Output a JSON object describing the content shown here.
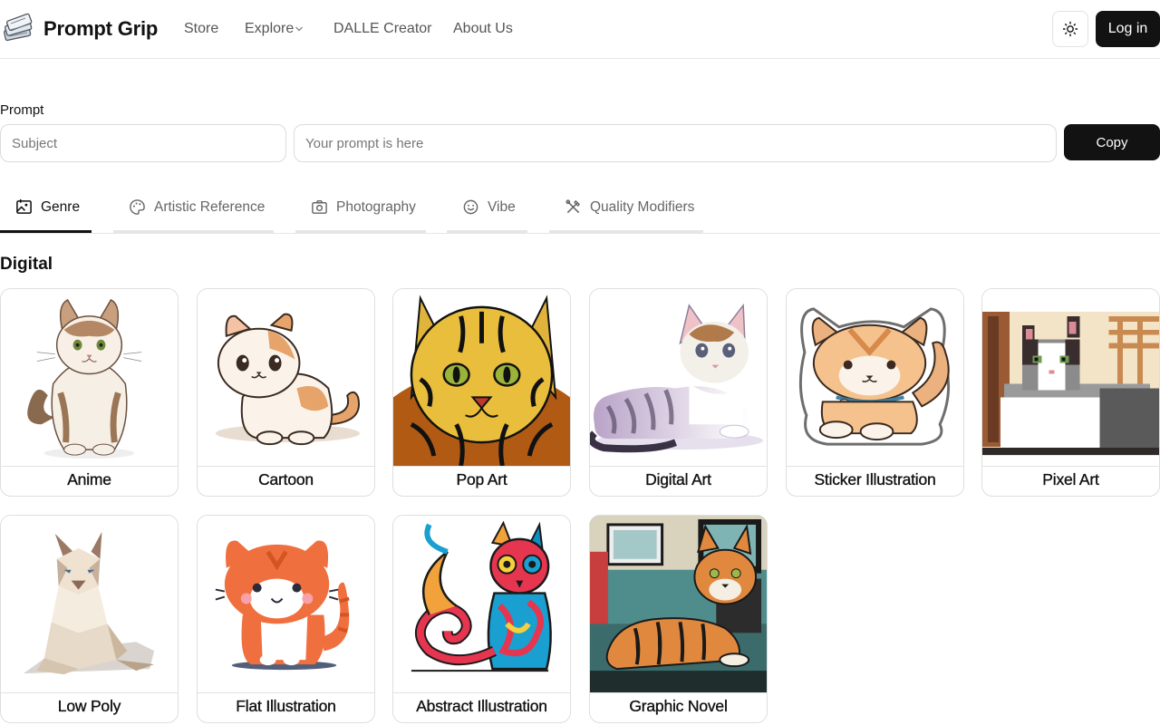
{
  "header": {
    "brand": "Prompt Grip",
    "nav": [
      {
        "label": "Store"
      },
      {
        "label": "Explore",
        "has_dropdown": true
      },
      {
        "label": "DALLE Creator"
      },
      {
        "label": "About Us"
      }
    ],
    "theme_icon": "sun-icon",
    "login_label": "Log in"
  },
  "prompt": {
    "label": "Prompt",
    "subject_placeholder": "Subject",
    "prompt_placeholder": "Your prompt is here",
    "copy_label": "Copy"
  },
  "tabs": [
    {
      "label": "Genre",
      "icon": "genre-icon",
      "active": true
    },
    {
      "label": "Artistic Reference",
      "icon": "palette-icon",
      "active": false
    },
    {
      "label": "Photography",
      "icon": "camera-icon",
      "active": false
    },
    {
      "label": "Vibe",
      "icon": "smiley-icon",
      "active": false
    },
    {
      "label": "Quality Modifiers",
      "icon": "tools-icon",
      "active": false
    }
  ],
  "section": {
    "title": "Digital",
    "cards": [
      {
        "label": "Anime"
      },
      {
        "label": "Cartoon"
      },
      {
        "label": "Pop Art"
      },
      {
        "label": "Digital Art"
      },
      {
        "label": "Sticker Illustration"
      },
      {
        "label": "Pixel Art"
      },
      {
        "label": "Low Poly"
      },
      {
        "label": "Flat Illustration"
      },
      {
        "label": "Abstract Illustration"
      },
      {
        "label": "Graphic Novel"
      }
    ]
  },
  "colors": {
    "primary_button": "#121212",
    "border": "#dedede",
    "text_muted": "#666666"
  }
}
